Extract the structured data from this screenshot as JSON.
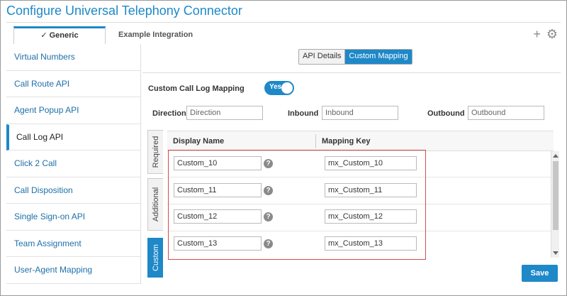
{
  "title": "Configure Universal Telephony Connector",
  "tabs": [
    {
      "label": "Generic",
      "active": true
    },
    {
      "label": "Example Integration",
      "active": false
    }
  ],
  "top_icons": [
    {
      "icon": "plus-icon",
      "glyph": "+"
    },
    {
      "icon": "gear-icon",
      "glyph": "⚙"
    }
  ],
  "sidebar": {
    "items": [
      {
        "label": "Virtual Numbers"
      },
      {
        "label": "Call Route API"
      },
      {
        "label": "Agent Popup API"
      },
      {
        "label": "Call Log API",
        "active": true
      },
      {
        "label": "Click 2 Call"
      },
      {
        "label": "Call Disposition"
      },
      {
        "label": "Single Sign-on API"
      },
      {
        "label": "Team Assignment"
      },
      {
        "label": "User-Agent Mapping"
      }
    ]
  },
  "segment": {
    "api_details": "API Details",
    "custom_mapping": "Custom Mapping",
    "selected": "Custom Mapping"
  },
  "custom_call_log": {
    "label": "Custom Call Log Mapping",
    "toggle": "Yes"
  },
  "direction": {
    "label": "Direction",
    "placeholder": "Direction"
  },
  "inbound": {
    "label": "Inbound",
    "placeholder": "Inbound"
  },
  "outbound": {
    "label": "Outbound",
    "placeholder": "Outbound"
  },
  "vertical_tabs": [
    {
      "label": "Required"
    },
    {
      "label": "Additional"
    },
    {
      "label": "Custom",
      "active": true
    }
  ],
  "grid": {
    "columns": [
      "Display Name",
      "Mapping Key"
    ],
    "rows": [
      {
        "display": "Custom_10",
        "key": "mx_Custom_10"
      },
      {
        "display": "Custom_11",
        "key": "mx_Custom_11"
      },
      {
        "display": "Custom_12",
        "key": "mx_Custom_12"
      },
      {
        "display": "Custom_13",
        "key": "mx_Custom_13"
      }
    ]
  },
  "help_glyph": "?",
  "save_label": "Save",
  "colors": {
    "accent": "#1e88c8",
    "highlight": "#d94a4a"
  }
}
